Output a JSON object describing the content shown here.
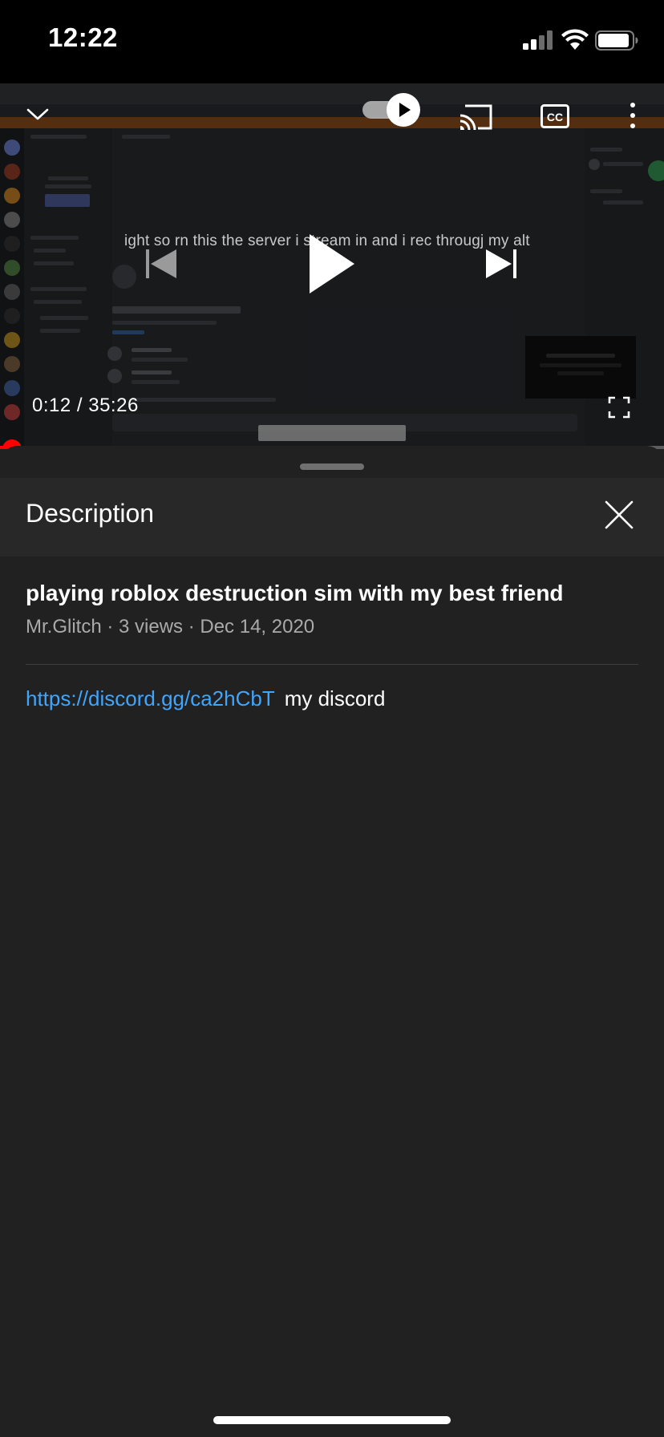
{
  "status_bar": {
    "time": "12:22"
  },
  "player": {
    "subtitle": "ight so rn this the server i stream in and i rec througj my alt",
    "current_time": "0:12",
    "separator": " / ",
    "duration": "35:26",
    "progress_fraction": 0.0056,
    "controls": {
      "collapse": "chevron-down-icon",
      "autoplay": "autoplay-toggle",
      "cast": "cast-icon",
      "captions": "cc-icon",
      "more": "more-vert-icon",
      "previous": "skip-previous-icon",
      "play": "play-icon",
      "next": "skip-next-icon",
      "fullscreen": "fullscreen-icon"
    }
  },
  "description_panel": {
    "title": "Description",
    "close_icon": "close-icon",
    "video_title": "playing roblox destruction sim with my best friend",
    "channel": "Mr.Glitch",
    "views": "3 views",
    "date": "Dec 14, 2020",
    "meta_separator": " · ",
    "link": "https://discord.gg/ca2hCbT",
    "link_text_after": "my discord"
  },
  "colors": {
    "background": "#212121",
    "header": "#282828",
    "link": "#3ea6ff",
    "progress": "#ff0000",
    "meta_text": "#aaaaaa"
  }
}
